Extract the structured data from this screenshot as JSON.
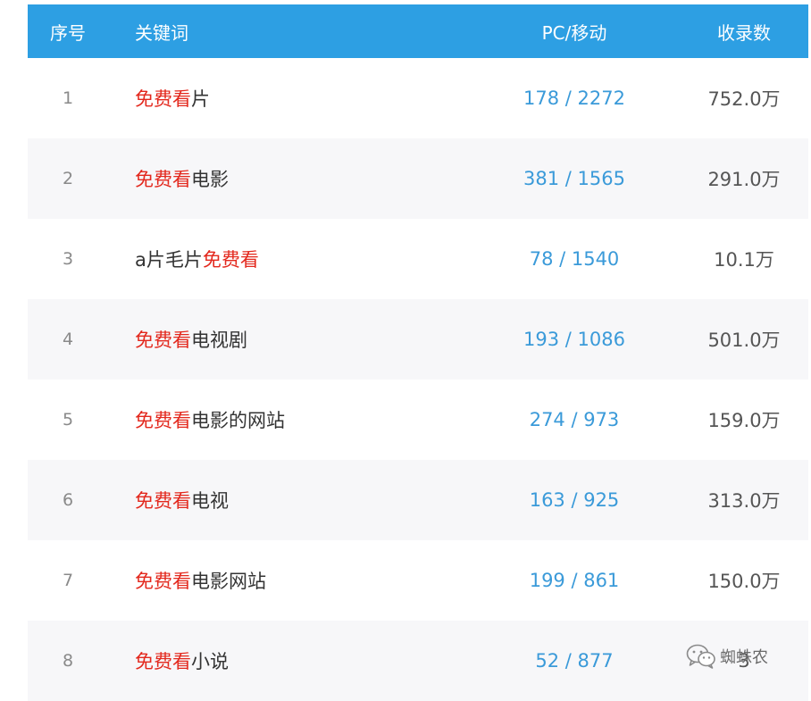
{
  "table": {
    "header": {
      "index": "序号",
      "keyword": "关键词",
      "pc_mobile": "PC/移动",
      "indexed": "收录数"
    },
    "highlight_term": "免费看",
    "rows": [
      {
        "index": "1",
        "keyword": [
          {
            "text": "免费看",
            "hl": true
          },
          {
            "text": "片",
            "hl": false
          }
        ],
        "pc_mobile": "178 / 2272",
        "indexed": "752.0万"
      },
      {
        "index": "2",
        "keyword": [
          {
            "text": "免费看",
            "hl": true
          },
          {
            "text": "电影",
            "hl": false
          }
        ],
        "pc_mobile": "381 / 1565",
        "indexed": "291.0万"
      },
      {
        "index": "3",
        "keyword": [
          {
            "text": "a片毛片",
            "hl": false
          },
          {
            "text": "免费看",
            "hl": true
          }
        ],
        "pc_mobile": "78 / 1540",
        "indexed": "10.1万"
      },
      {
        "index": "4",
        "keyword": [
          {
            "text": "免费看",
            "hl": true
          },
          {
            "text": "电视剧",
            "hl": false
          }
        ],
        "pc_mobile": "193 / 1086",
        "indexed": "501.0万"
      },
      {
        "index": "5",
        "keyword": [
          {
            "text": "免费看",
            "hl": true
          },
          {
            "text": "电影的网站",
            "hl": false
          }
        ],
        "pc_mobile": "274 / 973",
        "indexed": "159.0万"
      },
      {
        "index": "6",
        "keyword": [
          {
            "text": "免费看",
            "hl": true
          },
          {
            "text": "电视",
            "hl": false
          }
        ],
        "pc_mobile": "163 / 925",
        "indexed": "313.0万"
      },
      {
        "index": "7",
        "keyword": [
          {
            "text": "免费看",
            "hl": true
          },
          {
            "text": "电影网站",
            "hl": false
          }
        ],
        "pc_mobile": "199 / 861",
        "indexed": "150.0万"
      },
      {
        "index": "8",
        "keyword": [
          {
            "text": "免费看",
            "hl": true
          },
          {
            "text": "小说",
            "hl": false
          }
        ],
        "pc_mobile": "52 / 877",
        "indexed": "3"
      }
    ]
  },
  "watermark": {
    "text": "蜘蛛农",
    "icon": "wechat-icon"
  },
  "colors": {
    "header_bg": "#2d9fe3",
    "highlight": "#e3281d",
    "pc_mobile": "#3a9ad9",
    "row_alt": "#f7f7f9"
  }
}
